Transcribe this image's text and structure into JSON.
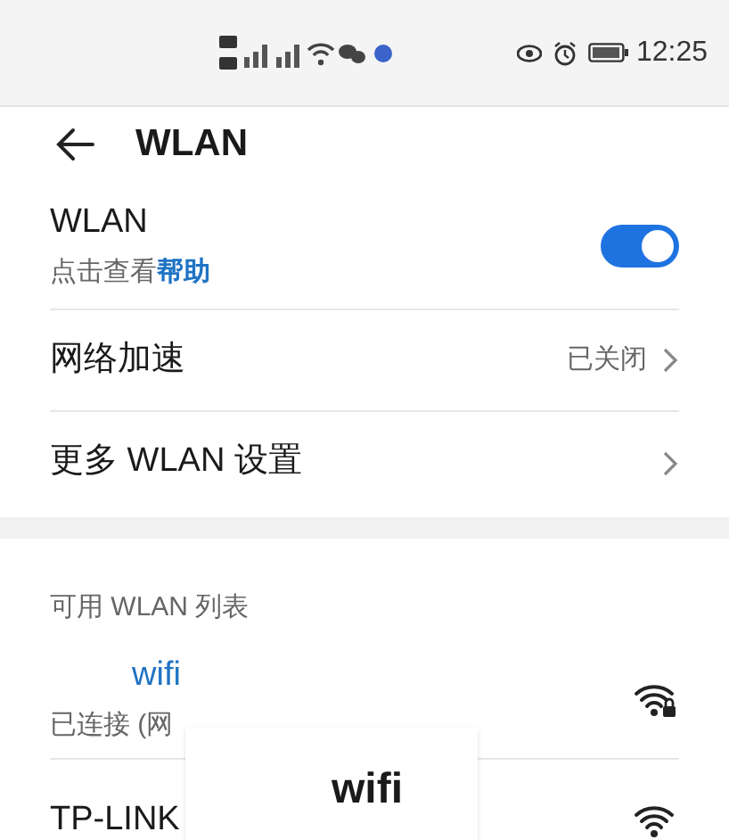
{
  "status_bar": {
    "time": "12:25"
  },
  "header": {
    "title": "WLAN"
  },
  "wlan_toggle": {
    "label": "WLAN",
    "hint": "点击查看",
    "hint_link": "帮助",
    "on": true
  },
  "settings": [
    {
      "label": "网络加速",
      "value": "已关闭"
    },
    {
      "label": "更多 WLAN 设置"
    }
  ],
  "section_title": "可用 WLAN 列表",
  "networks": [
    {
      "name": "wifi",
      "status": "已连接 (网",
      "connected": true
    },
    {
      "name": "TP-LINK",
      "connected": false
    }
  ],
  "overlay": {
    "text": "wifi"
  }
}
